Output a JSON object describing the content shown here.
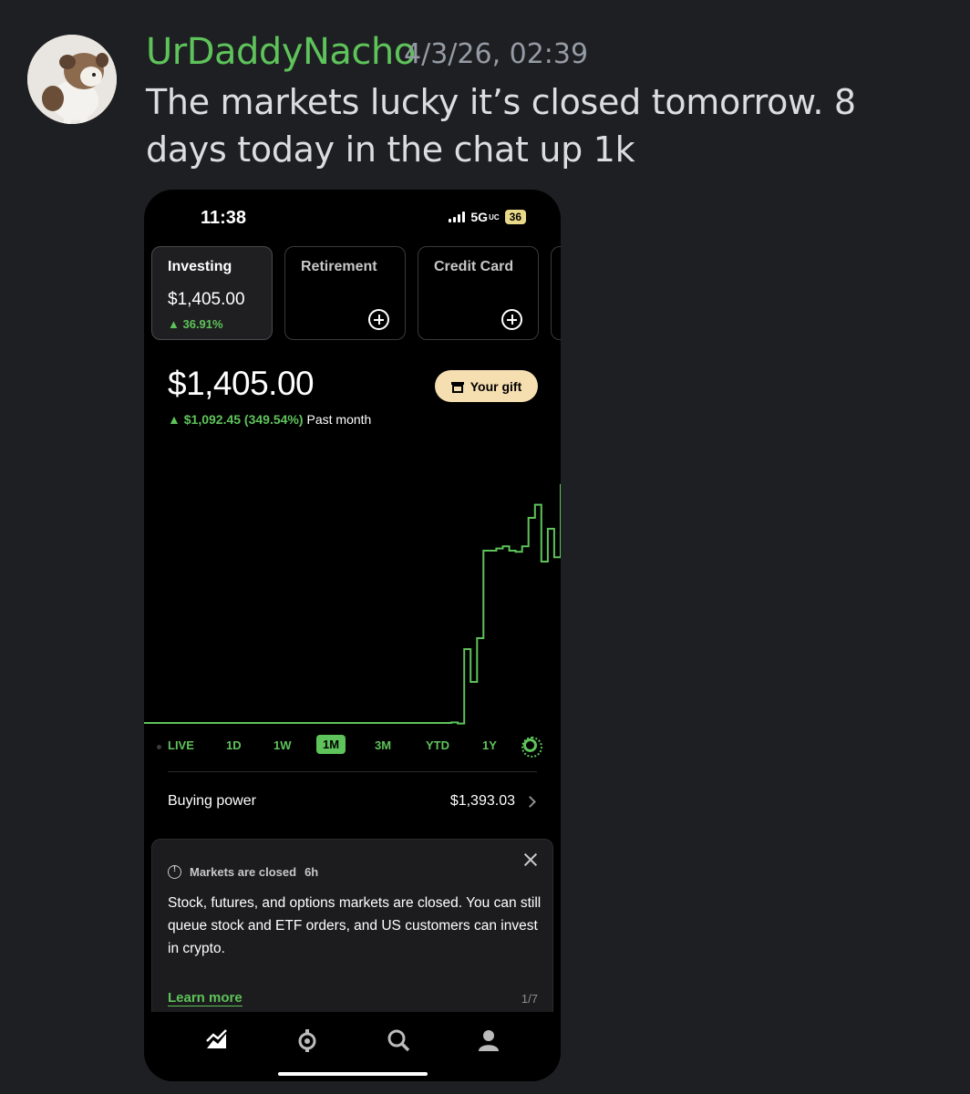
{
  "post": {
    "username": "UrDaddyNacho",
    "timestamp": "4/3/26, 02:39",
    "message": "The markets lucky it’s closed tomorrow. 8 days today in the chat up 1k"
  },
  "phone": {
    "status": {
      "time": "11:38",
      "network": "5G",
      "network_sub": "UC",
      "battery": "36"
    },
    "accounts": [
      {
        "title": "Investing",
        "value": "$1,405.00",
        "change": "▲ 36.91%"
      },
      {
        "title": "Retirement"
      },
      {
        "title": "Credit Card"
      }
    ],
    "portfolio": {
      "balance": "$1,405.00",
      "change": "▲ $1,092.45 (349.54%)",
      "period": "Past month",
      "gift_label": "Your gift"
    },
    "ranges": [
      "LIVE",
      "1D",
      "1W",
      "1M",
      "3M",
      "YTD",
      "1Y"
    ],
    "active_range": "1M",
    "buying_power": {
      "label": "Buying power",
      "value": "$1,393.03"
    },
    "notice": {
      "title": "Markets are closed",
      "time": "6h",
      "body": "Stock, futures, and options markets are closed. You can still queue stock and ETF orders, and US customers can invest in crypto.",
      "link": "Learn more",
      "pager": "1/7"
    },
    "colors": {
      "accent": "#5ec35a",
      "gift": "#f5deb0",
      "background": "#000000"
    },
    "tabs": [
      "chart-icon",
      "discover-icon",
      "search-icon",
      "profile-icon"
    ]
  },
  "chart_data": {
    "type": "line",
    "title": "",
    "xlabel": "",
    "ylabel": "",
    "series": [
      {
        "values": [
          312.55,
          312.55,
          312.6,
          312.6,
          312.55,
          312.55,
          312.55,
          312.6,
          312.6,
          312.55,
          312.55,
          312.55,
          312.55,
          315,
          310,
          650,
          500,
          700,
          1100,
          1100,
          1110,
          1120,
          1100,
          1095,
          1120,
          1250,
          1310,
          1050,
          1200,
          1070,
          1405
        ]
      }
    ],
    "ylim": [
      250,
      1500
    ],
    "grid": false
  }
}
